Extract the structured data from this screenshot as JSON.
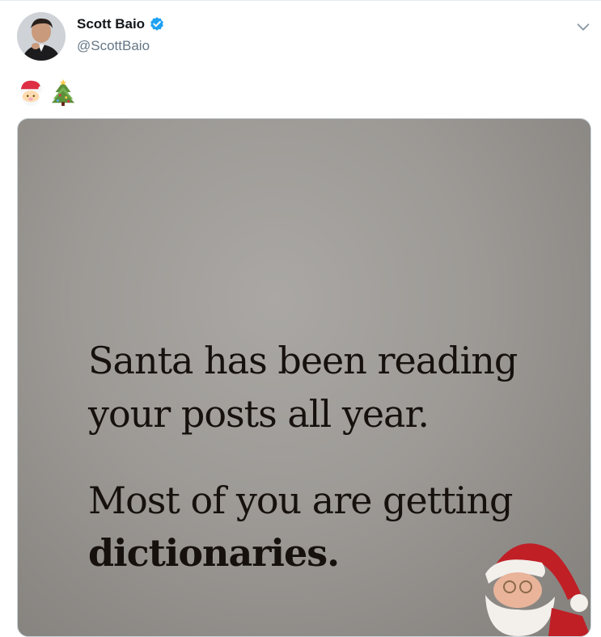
{
  "tweet": {
    "author": {
      "display_name": "Scott Baio",
      "handle": "@ScottBaio",
      "verified": true,
      "avatar_icon": "profile-photo"
    },
    "menu_icon": "chevron-down-icon",
    "text_emojis": [
      "santa-emoji",
      "christmas-tree-emoji"
    ],
    "media": {
      "lines": [
        "Santa has been reading",
        "your posts all year.",
        "Most of you are getting",
        "dictionaries."
      ],
      "decoration": "santa-claus-image"
    }
  },
  "colors": {
    "verified_blue": "#1da1f2",
    "handle_gray": "#657786",
    "text_dark": "#14171a",
    "media_background": "#9d9a96"
  }
}
